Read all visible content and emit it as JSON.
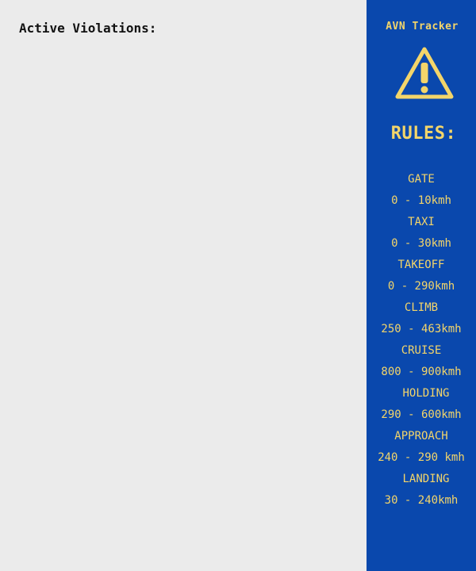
{
  "main": {
    "violations_label": "Active Violations:"
  },
  "sidebar": {
    "title": "AVN Tracker",
    "warning_icon": "warning-triangle-icon",
    "rules_heading": "RULES:",
    "rules": [
      {
        "phase": "GATE",
        "range": "0 - 10kmh"
      },
      {
        "phase": "TAXI",
        "range": "0 - 30kmh"
      },
      {
        "phase": "TAKEOFF",
        "range": "0 - 290kmh"
      },
      {
        "phase": "CLIMB",
        "range": "250 - 463kmh"
      },
      {
        "phase": "CRUISE",
        "range": "800 - 900kmh"
      },
      {
        "phase": "HOLDING",
        "range": "290 - 600kmh"
      },
      {
        "phase": "APPROACH",
        "range": "240 - 290 kmh"
      },
      {
        "phase": "LANDING",
        "range": "30 - 240kmh"
      }
    ]
  },
  "colors": {
    "background": "#ebebeb",
    "sidebar_bg": "#0a48ad",
    "accent_yellow": "#f3d56a",
    "text_dark": "#111111"
  }
}
